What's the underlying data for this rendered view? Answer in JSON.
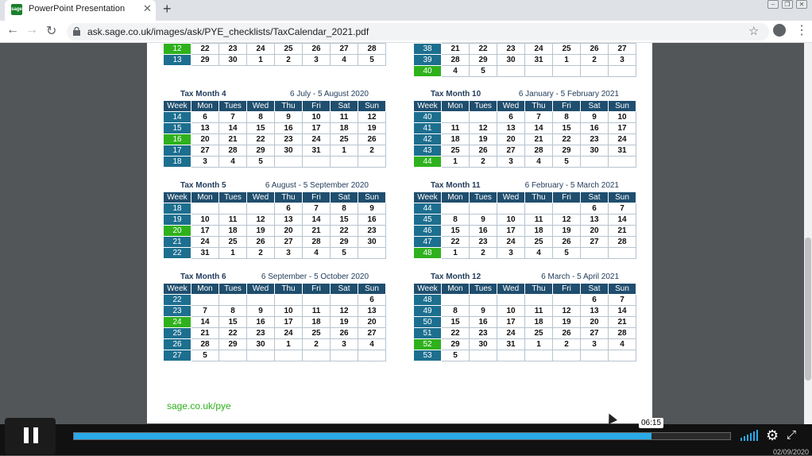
{
  "browser": {
    "tab_title": "PowerPoint Presentation",
    "favicon_text": "sage",
    "url": "ask.sage.co.uk/images/ask/PYE_checklists/TaxCalendar_2021.pdf"
  },
  "colors": {
    "header_blue": "#1f4e6e",
    "week_teal": "#1d6f8f",
    "payday_green": "#2fb11d",
    "progress_blue": "#29a9e8"
  },
  "pdf": {
    "headers": [
      "Week",
      "Mon",
      "Tues",
      "Wed",
      "Thu",
      "Fri",
      "Sat",
      "Sun"
    ],
    "footer_link": "sage.co.uk/pye",
    "top_left": [
      {
        "week": "12",
        "pay": true,
        "days": [
          "22",
          "23",
          "24",
          "25",
          "26",
          "27",
          "28"
        ]
      },
      {
        "week": "13",
        "pay": false,
        "days": [
          "29",
          "30",
          "1",
          "2",
          "3",
          "4",
          "5"
        ]
      }
    ],
    "top_right": [
      {
        "week": "38",
        "pay": false,
        "days": [
          "21",
          "22",
          "23",
          "24",
          "25",
          "26",
          "27"
        ]
      },
      {
        "week": "39",
        "pay": false,
        "days": [
          "28",
          "29",
          "30",
          "31",
          "1",
          "2",
          "3"
        ]
      },
      {
        "week": "40",
        "pay": true,
        "days": [
          "4",
          "5",
          "",
          "",
          "",
          "",
          ""
        ]
      }
    ],
    "months": [
      {
        "title": "Tax Month 4",
        "range": "6 July - 5 August 2020",
        "rows": [
          {
            "week": "14",
            "pay": false,
            "days": [
              "6",
              "7",
              "8",
              "9",
              "10",
              "11",
              "12"
            ]
          },
          {
            "week": "15",
            "pay": false,
            "days": [
              "13",
              "14",
              "15",
              "16",
              "17",
              "18",
              "19"
            ]
          },
          {
            "week": "16",
            "pay": true,
            "days": [
              "20",
              "21",
              "22",
              "23",
              "24",
              "25",
              "26"
            ]
          },
          {
            "week": "17",
            "pay": false,
            "days": [
              "27",
              "28",
              "29",
              "30",
              "31",
              "1",
              "2"
            ]
          },
          {
            "week": "18",
            "pay": false,
            "days": [
              "3",
              "4",
              "5",
              "",
              "",
              "",
              ""
            ]
          }
        ]
      },
      {
        "title": "Tax Month 10",
        "range": "6 January - 5 February 2021",
        "rows": [
          {
            "week": "40",
            "pay": false,
            "days": [
              "",
              "",
              "6",
              "7",
              "8",
              "9",
              "10"
            ]
          },
          {
            "week": "41",
            "pay": false,
            "days": [
              "11",
              "12",
              "13",
              "14",
              "15",
              "16",
              "17"
            ]
          },
          {
            "week": "42",
            "pay": false,
            "days": [
              "18",
              "19",
              "20",
              "21",
              "22",
              "23",
              "24"
            ]
          },
          {
            "week": "43",
            "pay": false,
            "days": [
              "25",
              "26",
              "27",
              "28",
              "29",
              "30",
              "31"
            ]
          },
          {
            "week": "44",
            "pay": true,
            "days": [
              "1",
              "2",
              "3",
              "4",
              "5",
              "",
              ""
            ]
          }
        ]
      },
      {
        "title": "Tax Month 5",
        "range": "6 August - 5 September 2020",
        "rows": [
          {
            "week": "18",
            "pay": false,
            "days": [
              "",
              "",
              "",
              "6",
              "7",
              "8",
              "9"
            ]
          },
          {
            "week": "19",
            "pay": false,
            "days": [
              "10",
              "11",
              "12",
              "13",
              "14",
              "15",
              "16"
            ]
          },
          {
            "week": "20",
            "pay": true,
            "days": [
              "17",
              "18",
              "19",
              "20",
              "21",
              "22",
              "23"
            ]
          },
          {
            "week": "21",
            "pay": false,
            "days": [
              "24",
              "25",
              "26",
              "27",
              "28",
              "29",
              "30"
            ]
          },
          {
            "week": "22",
            "pay": false,
            "days": [
              "31",
              "1",
              "2",
              "3",
              "4",
              "5",
              ""
            ]
          }
        ]
      },
      {
        "title": "Tax Month 11",
        "range": "6 February - 5 March 2021",
        "rows": [
          {
            "week": "44",
            "pay": false,
            "days": [
              "",
              "",
              "",
              "",
              "",
              "6",
              "7"
            ]
          },
          {
            "week": "45",
            "pay": false,
            "days": [
              "8",
              "9",
              "10",
              "11",
              "12",
              "13",
              "14"
            ]
          },
          {
            "week": "46",
            "pay": false,
            "days": [
              "15",
              "16",
              "17",
              "18",
              "19",
              "20",
              "21"
            ]
          },
          {
            "week": "47",
            "pay": false,
            "days": [
              "22",
              "23",
              "24",
              "25",
              "26",
              "27",
              "28"
            ]
          },
          {
            "week": "48",
            "pay": true,
            "days": [
              "1",
              "2",
              "3",
              "4",
              "5",
              "",
              ""
            ]
          }
        ]
      },
      {
        "title": "Tax Month 6",
        "range": "6 September - 5 October 2020",
        "rows": [
          {
            "week": "22",
            "pay": false,
            "days": [
              "",
              "",
              "",
              "",
              "",
              "",
              "6"
            ]
          },
          {
            "week": "23",
            "pay": false,
            "days": [
              "7",
              "8",
              "9",
              "10",
              "11",
              "12",
              "13"
            ]
          },
          {
            "week": "24",
            "pay": true,
            "days": [
              "14",
              "15",
              "16",
              "17",
              "18",
              "19",
              "20"
            ]
          },
          {
            "week": "25",
            "pay": false,
            "days": [
              "21",
              "22",
              "23",
              "24",
              "25",
              "26",
              "27"
            ]
          },
          {
            "week": "26",
            "pay": false,
            "days": [
              "28",
              "29",
              "30",
              "1",
              "2",
              "3",
              "4"
            ]
          },
          {
            "week": "27",
            "pay": false,
            "days": [
              "5",
              "",
              "",
              "",
              "",
              "",
              ""
            ]
          }
        ]
      },
      {
        "title": "Tax Month 12",
        "range": "6 March - 5 April 2021",
        "rows": [
          {
            "week": "48",
            "pay": false,
            "days": [
              "",
              "",
              "",
              "",
              "",
              "6",
              "7"
            ]
          },
          {
            "week": "49",
            "pay": false,
            "days": [
              "8",
              "9",
              "10",
              "11",
              "12",
              "13",
              "14"
            ]
          },
          {
            "week": "50",
            "pay": false,
            "days": [
              "15",
              "16",
              "17",
              "18",
              "19",
              "20",
              "21"
            ]
          },
          {
            "week": "51",
            "pay": false,
            "days": [
              "22",
              "23",
              "24",
              "25",
              "26",
              "27",
              "28"
            ]
          },
          {
            "week": "52",
            "pay": true,
            "days": [
              "29",
              "30",
              "31",
              "1",
              "2",
              "3",
              "4"
            ]
          },
          {
            "week": "53",
            "pay": false,
            "days": [
              "5",
              "",
              "",
              "",
              "",
              "",
              ""
            ]
          }
        ]
      }
    ]
  },
  "player": {
    "timecode": "06:15",
    "progress": 0.88,
    "date": "02/09/2020"
  }
}
